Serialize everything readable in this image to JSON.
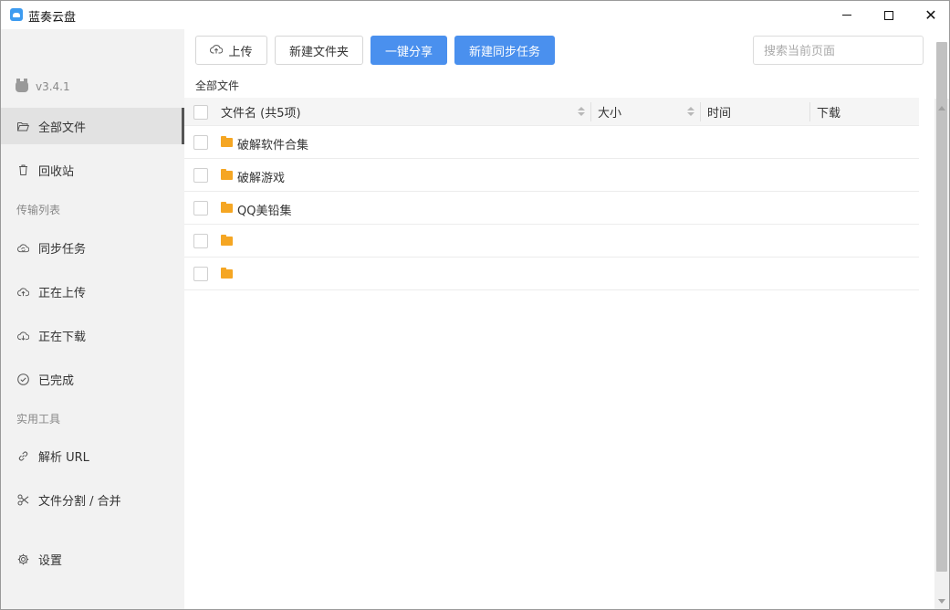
{
  "window": {
    "title": "蓝奏云盘"
  },
  "sidebar": {
    "version": "v3.4.1",
    "items": [
      {
        "label": "全部文件",
        "icon": "folder-open-icon",
        "active": true
      },
      {
        "label": "回收站",
        "icon": "trash-icon",
        "active": false
      }
    ],
    "transfer_section": "传输列表",
    "transfer_items": [
      {
        "label": "同步任务",
        "icon": "cloud-sync-icon"
      },
      {
        "label": "正在上传",
        "icon": "cloud-upload-icon"
      },
      {
        "label": "正在下载",
        "icon": "cloud-download-icon"
      },
      {
        "label": "已完成",
        "icon": "check-circle-icon"
      }
    ],
    "tools_section": "实用工具",
    "tool_items": [
      {
        "label": "解析 URL",
        "icon": "link-icon"
      },
      {
        "label": "文件分割 / 合并",
        "icon": "scissors-icon"
      }
    ],
    "settings_label": "设置"
  },
  "toolbar": {
    "upload_label": "上传",
    "new_folder_label": "新建文件夹",
    "share_label": "一键分享",
    "new_sync_label": "新建同步任务",
    "search_placeholder": "搜索当前页面"
  },
  "breadcrumb": "全部文件",
  "table": {
    "columns": {
      "name": "文件名 (共5项)",
      "size": "大小",
      "time": "时间",
      "download": "下载"
    },
    "rows": [
      {
        "name": "破解软件合集",
        "type": "folder"
      },
      {
        "name": "破解游戏",
        "type": "folder"
      },
      {
        "name": "QQ美铅集",
        "type": "folder"
      },
      {
        "name": "",
        "type": "folder"
      },
      {
        "name": "",
        "type": "folder"
      }
    ]
  },
  "colors": {
    "primary": "#4a90ee",
    "folder": "#f5a623",
    "sidebar_bg": "#f2f2f2"
  }
}
